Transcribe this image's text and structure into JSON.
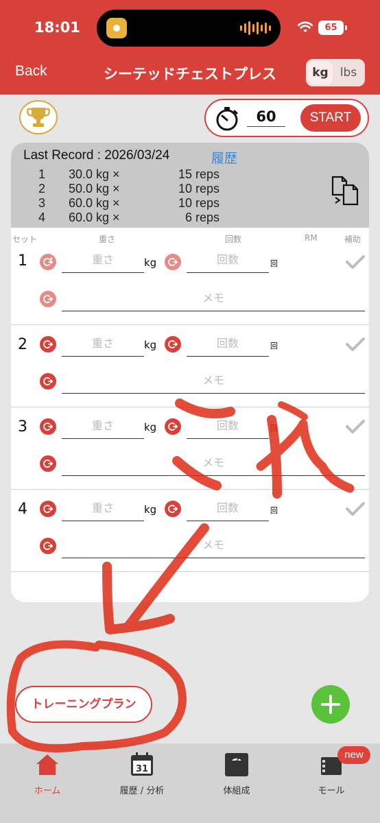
{
  "status": {
    "time": "18:01",
    "battery": "65"
  },
  "nav": {
    "back_label": "Back",
    "title": "シーテッドチェストプレス",
    "unit_kg": "kg",
    "unit_lbs": "lbs"
  },
  "timer": {
    "value": "60",
    "start_label": "START"
  },
  "last_record": {
    "title": "Last Record : 2026/03/24",
    "history_label": "履歴",
    "rows": [
      {
        "num": "1",
        "weight": "30.0 kg ×",
        "reps": "15 reps"
      },
      {
        "num": "2",
        "weight": "50.0 kg ×",
        "reps": "10 reps"
      },
      {
        "num": "3",
        "weight": "60.0 kg ×",
        "reps": "10 reps"
      },
      {
        "num": "4",
        "weight": "60.0 kg ×",
        "reps": "6 reps"
      }
    ]
  },
  "columns": {
    "set": "セット",
    "weight": "重さ",
    "reps": "回数",
    "rm": "RM",
    "assist": "補助"
  },
  "sets": [
    {
      "num": "1",
      "weight_placeholder": "重さ",
      "unit": "kg",
      "reps_placeholder": "回数",
      "reps_unit": "回",
      "memo_placeholder": "メモ"
    },
    {
      "num": "2",
      "weight_placeholder": "重さ",
      "unit": "kg",
      "reps_placeholder": "回数",
      "reps_unit": "回",
      "memo_placeholder": "メモ"
    },
    {
      "num": "3",
      "weight_placeholder": "重さ",
      "unit": "kg",
      "reps_placeholder": "回数",
      "reps_unit": "回",
      "memo_placeholder": "メモ"
    },
    {
      "num": "4",
      "weight_placeholder": "重さ",
      "unit": "kg",
      "reps_placeholder": "回数",
      "reps_unit": "回",
      "memo_placeholder": "メモ"
    }
  ],
  "plan_button_label": "トレーニングプラン",
  "tabs": [
    {
      "label": "ホーム",
      "icon": "home-icon"
    },
    {
      "label": "履歴 / 分析",
      "icon": "calendar-icon",
      "calendar_day": "31"
    },
    {
      "label": "体組成",
      "icon": "scale-icon"
    },
    {
      "label": "モール",
      "icon": "store-icon"
    }
  ],
  "new_badge": "new",
  "annotation": {
    "text": "これ"
  },
  "colors": {
    "accent": "#d9403a",
    "add": "#5ac23a",
    "link": "#3a86d8"
  }
}
